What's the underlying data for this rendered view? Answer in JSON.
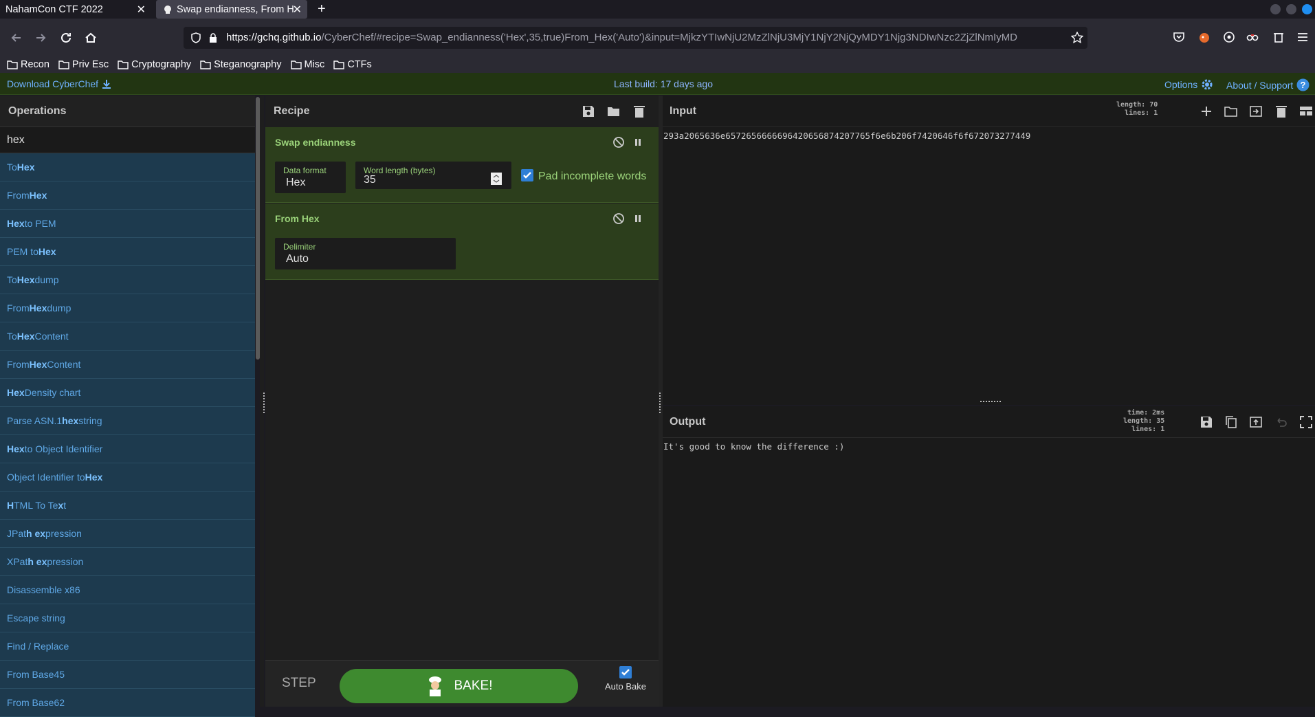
{
  "browser": {
    "tabs": [
      {
        "title": "NahamCon CTF 2022"
      },
      {
        "title": "Swap endianness, From H"
      }
    ],
    "url_host": "https://gchq.github.io",
    "url_rest": "/CyberChef/#recipe=Swap_endianness('Hex',35,true)From_Hex('Auto')&input=MjkzYTIwNjU2MzZlNjU3MjY1NjY2NjQyMDY1Njg3NDIwNzc2ZjZlNmIyMD",
    "bookmarks": [
      "Recon",
      "Priv Esc",
      "Cryptography",
      "Steganography",
      "Misc",
      "CTFs"
    ]
  },
  "banner": {
    "download": "Download CyberChef",
    "last_build": "Last build: 17 days ago",
    "options": "Options",
    "about": "About / Support"
  },
  "operations": {
    "title": "Operations",
    "search": "hex",
    "items": [
      {
        "pre": "To ",
        "bold": "Hex",
        "post": ""
      },
      {
        "pre": "From ",
        "bold": "Hex",
        "post": ""
      },
      {
        "pre": "",
        "bold": "Hex",
        "post": " to PEM"
      },
      {
        "pre": "PEM to ",
        "bold": "Hex",
        "post": ""
      },
      {
        "pre": "To ",
        "bold": "Hex",
        "post": "dump"
      },
      {
        "pre": "From ",
        "bold": "Hex",
        "post": "dump"
      },
      {
        "pre": "To ",
        "bold": "Hex",
        "post": " Content"
      },
      {
        "pre": "From ",
        "bold": "Hex",
        "post": " Content"
      },
      {
        "pre": "",
        "bold": "Hex",
        "post": " Density chart"
      },
      {
        "pre": "Parse ASN.1 ",
        "bold": "hex",
        "post": " string"
      },
      {
        "pre": "",
        "bold": "Hex",
        "post": " to Object Identifier"
      },
      {
        "pre": "Object Identifier to ",
        "bold": "Hex",
        "post": ""
      },
      {
        "pre": "",
        "bold": "H",
        "post": "TML To Te",
        "bold2": "x",
        "post2": "t"
      },
      {
        "pre": "JPat",
        "bold": "h ex",
        "post": "pression"
      },
      {
        "pre": "XPat",
        "bold": "h ex",
        "post": "pression"
      },
      {
        "pre": "Disassemble x86",
        "bold": "",
        "post": ""
      },
      {
        "pre": "Escape string",
        "bold": "",
        "post": ""
      },
      {
        "pre": "Find / Replace",
        "bold": "",
        "post": ""
      },
      {
        "pre": "From Base45",
        "bold": "",
        "post": ""
      },
      {
        "pre": "From Base62",
        "bold": "",
        "post": ""
      }
    ]
  },
  "recipe": {
    "title": "Recipe",
    "swap": {
      "title": "Swap endianness",
      "data_format_label": "Data format",
      "data_format": "Hex",
      "word_length_label": "Word length (bytes)",
      "word_length": "35",
      "pad_label": "Pad incomplete words"
    },
    "fromhex": {
      "title": "From Hex",
      "delimiter_label": "Delimiter",
      "delimiter": "Auto"
    },
    "step": "STEP",
    "bake": "BAKE!",
    "auto_bake": "Auto Bake"
  },
  "input": {
    "title": "Input",
    "length_label": "length:",
    "length": "70",
    "lines_label": "lines:",
    "lines": "1",
    "text": "293a2065636e6572656666696420656874207765f6e6b206f7420646f6f672073277449"
  },
  "output": {
    "title": "Output",
    "time_label": "time:",
    "time": "2ms",
    "length_label": "length:",
    "length": "35",
    "lines_label": "lines:",
    "lines": "1",
    "text": "It's good to know the difference :)"
  },
  "colors": {
    "banner_bg": "#223512",
    "ingredient_bg": "#2c3e1c",
    "op_bg": "#1d3a4e",
    "bake_green": "#3e8a2f",
    "link_blue": "#6fb1ff"
  }
}
